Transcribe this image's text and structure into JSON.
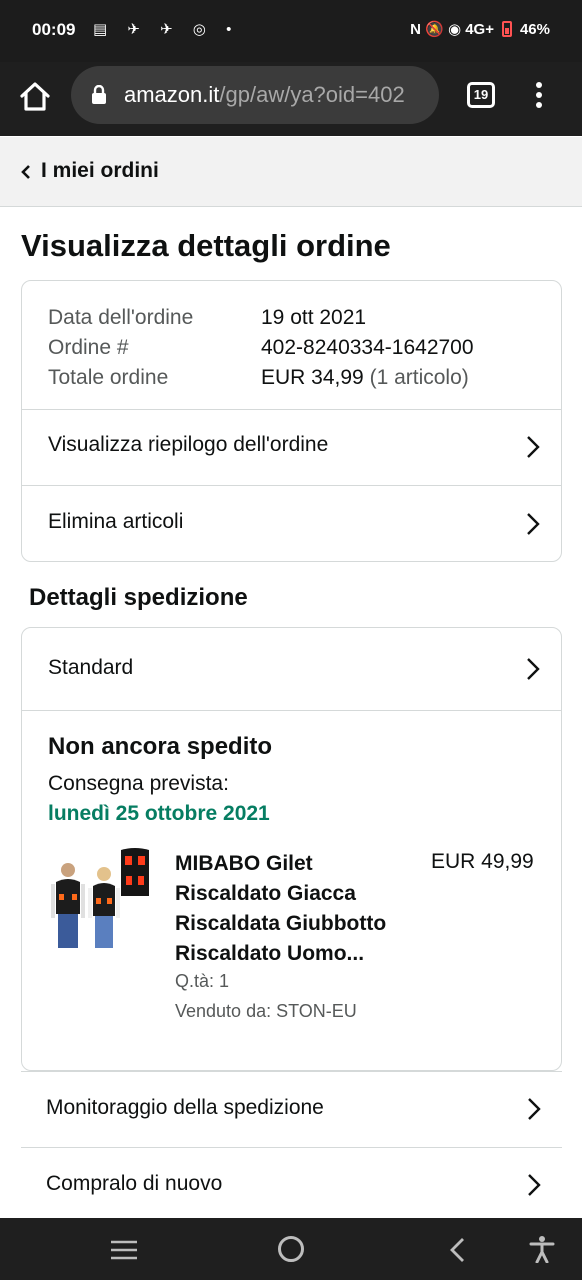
{
  "status_bar": {
    "time": "00:09",
    "notifications": "▤ ✈ ✈ ◎ •",
    "indicators": "N 🔕 ◉ 4G+",
    "battery": "46%"
  },
  "browser": {
    "url_host": "amazon.it",
    "url_path": "/gp/aw/ya?oid=402",
    "tab_count": "19"
  },
  "back_nav": {
    "label": "I miei ordini"
  },
  "page_title": "Visualizza dettagli ordine",
  "order_summary": {
    "labels": {
      "date": "Data dell'ordine",
      "number": "Ordine #",
      "total": "Totale ordine"
    },
    "values": {
      "date": "19 ott 2021",
      "number": "402-8240334-1642700",
      "total": "EUR 34,99",
      "items": "(1 articolo)"
    },
    "rows": [
      "Visualizza riepilogo dell'ordine",
      "Elimina articoli"
    ]
  },
  "shipping": {
    "section_title": "Dettagli spedizione",
    "method": "Standard",
    "status": "Non ancora spedito",
    "delivery_label": "Consegna prevista:",
    "delivery_date": "lunedì 25 ottobre 2021",
    "product": {
      "title": "MIBABO Gilet Riscaldato Giacca Riscaldata Giubbotto Riscaldato Uomo...",
      "price": "EUR 49,99",
      "quantity": "Q.tà: 1",
      "seller": "Venduto da: STON-EU"
    }
  },
  "actions": [
    "Monitoraggio della spedizione",
    "Compralo di nuovo"
  ],
  "colors": {
    "green": "#067d62",
    "border": "#d5d9d9"
  }
}
